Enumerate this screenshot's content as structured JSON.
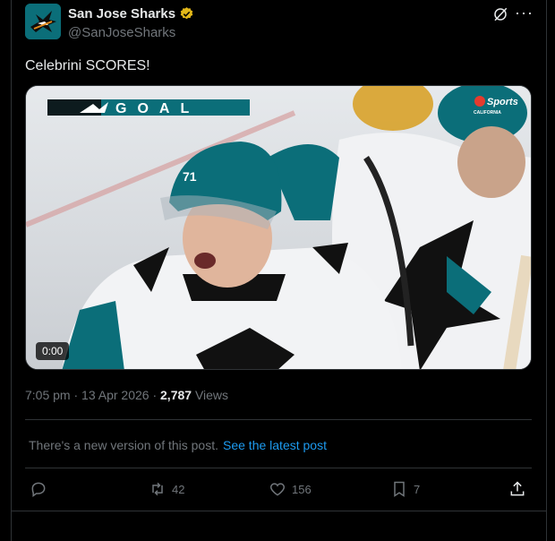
{
  "account": {
    "name": "San Jose Sharks",
    "handle": "@SanJoseSharks"
  },
  "post": {
    "text": "Celebrini SCORES!",
    "video_time": "0:00",
    "overlay_title": "GOAL",
    "broadcaster": "Sports",
    "broadcaster_region": "CALIFORNIA",
    "jersey_number": "71"
  },
  "meta": {
    "time": "7:05 pm",
    "date": "13 Apr 2026",
    "dot": "·",
    "views_count": "2,787",
    "views_label": "Views"
  },
  "notice": {
    "text": "There's a new version of this post.",
    "link": "See the latest post"
  },
  "actions": {
    "reposts": "42",
    "likes": "156",
    "bookmarks": "7"
  },
  "colors": {
    "background": "#000000",
    "accent": "#1d9bf0",
    "teal": "#006d75",
    "verified": "#e2b719"
  }
}
